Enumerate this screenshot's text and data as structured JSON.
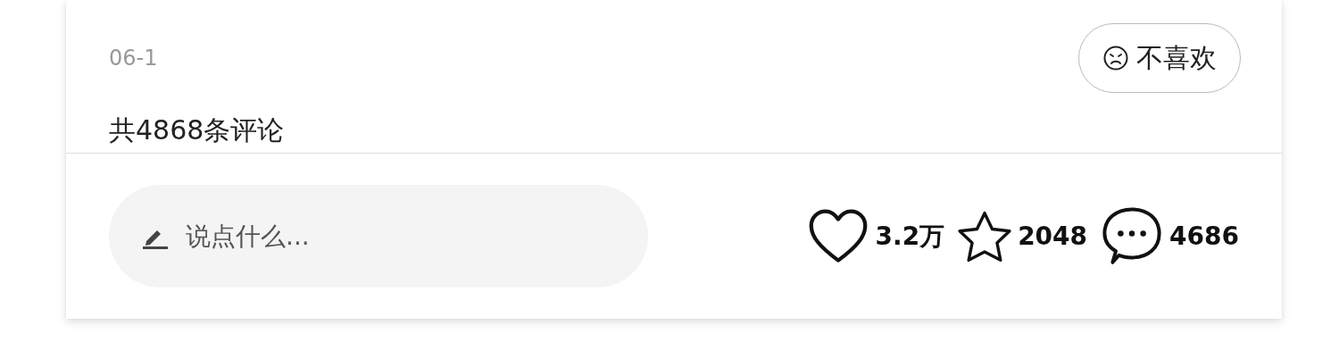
{
  "post": {
    "date": "06-1",
    "dislike_button": {
      "label": "不喜欢"
    }
  },
  "comments": {
    "count_label": "共4868条评论"
  },
  "bottom_bar": {
    "comment_field": {
      "placeholder": "说点什么..."
    },
    "stats": [
      {
        "kind": "like",
        "count": "3.2万"
      },
      {
        "kind": "collect",
        "count": "2048"
      },
      {
        "kind": "comment",
        "count": "4686"
      }
    ]
  }
}
